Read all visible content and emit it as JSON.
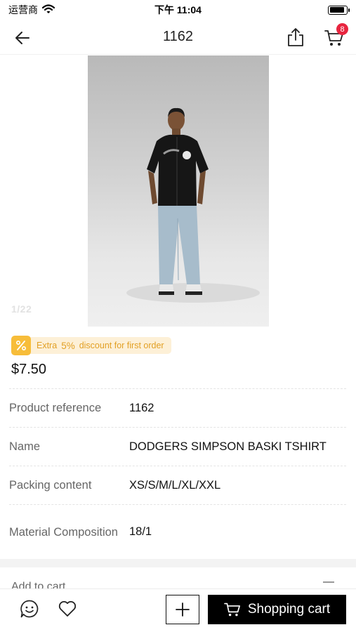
{
  "status_bar": {
    "carrier": "运营商",
    "time": "下午 11:04",
    "battery_level": 0.9
  },
  "nav": {
    "title": "1162",
    "cart_count": "8"
  },
  "gallery": {
    "counter": "1/22"
  },
  "promo": {
    "prefix": "Extra",
    "percent": "5%",
    "suffix": "discount for first order"
  },
  "price": "$7.50",
  "attributes": [
    {
      "label": "Product reference",
      "value": "1162"
    },
    {
      "label": "Name",
      "value": "DODGERS SIMPSON BASKI TSHIRT"
    },
    {
      "label": "Packing content",
      "value": "XS/S/M/L/XL/XXL"
    },
    {
      "label": "Material Composition",
      "value": "18/1"
    }
  ],
  "next_section": {
    "label": "Add to cart"
  },
  "bottom_bar": {
    "cart_label": "Shopping cart"
  },
  "colors": {
    "accent": "#e8253f",
    "promo": "#f7bd3a",
    "promo_bg": "#fdf0d7",
    "primary_button": "#000000"
  }
}
